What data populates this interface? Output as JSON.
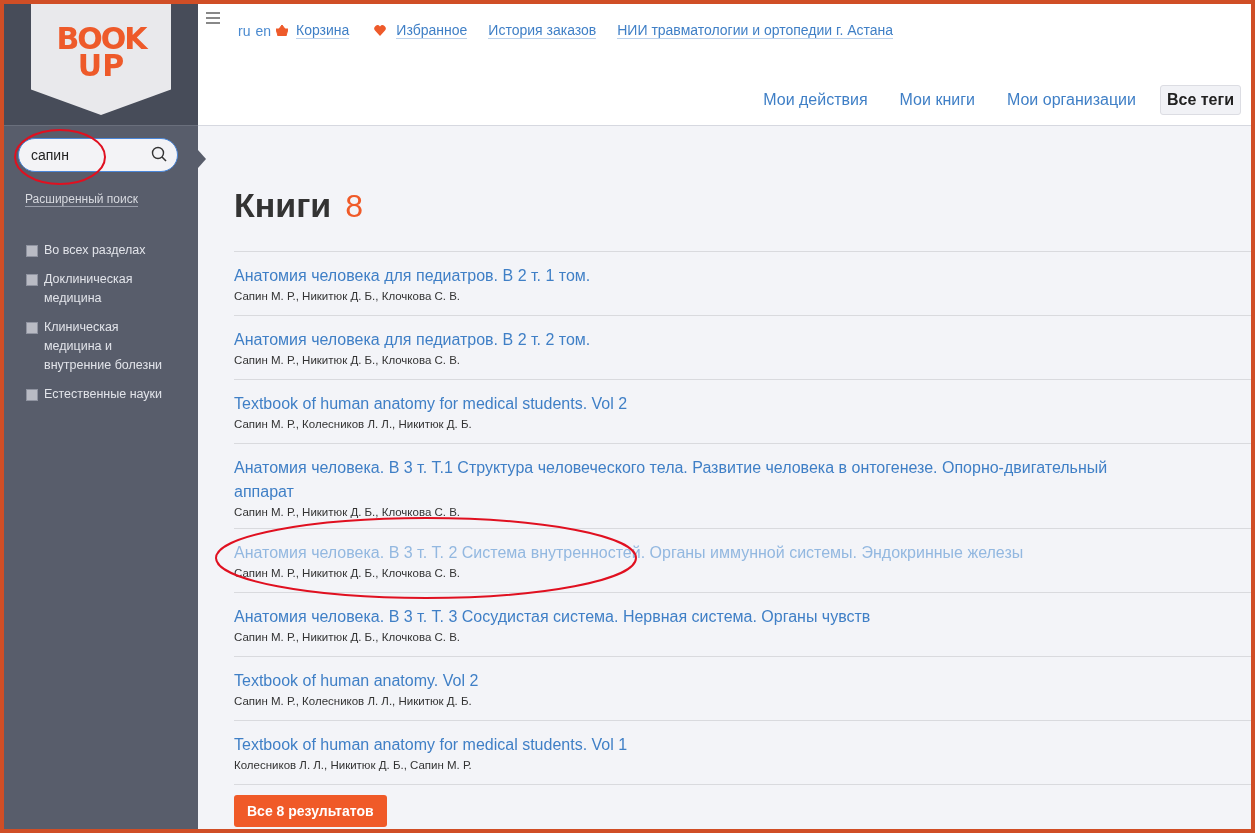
{
  "logo": {
    "top": "BOOK",
    "bottom": "UP"
  },
  "search": {
    "value": "сапин"
  },
  "advanced_search": "Расширенный поиск",
  "sections": [
    {
      "label": "Во всех разделах",
      "checked": false
    },
    {
      "label": "Доклиническая медицина",
      "checked": false
    },
    {
      "label": "Клиническая медицина и внутренние болезни",
      "checked": false
    },
    {
      "label": "Естественные науки",
      "checked": false
    }
  ],
  "top_links": {
    "languages": [
      "ru",
      "en"
    ],
    "items": [
      {
        "label": "Корзина",
        "kind": "cart"
      },
      {
        "label": "Избранное",
        "kind": "favorites"
      },
      {
        "label": "История заказов",
        "kind": "plain"
      },
      {
        "label": "НИИ травматологии и ортопедии г. Астана",
        "kind": "plain"
      }
    ]
  },
  "nav": [
    {
      "label": "Мои действия",
      "selected": false
    },
    {
      "label": "Мои книги",
      "selected": false
    },
    {
      "label": "Мои организации",
      "selected": false
    },
    {
      "label": "Все теги",
      "selected": true
    }
  ],
  "heading": {
    "title": "Книги",
    "count": "8"
  },
  "books": [
    {
      "title": "Анатомия человека для педиатров. В 2 т. 1 том.",
      "authors": "Сапин М. Р., Никитюк Д. Б., Клочкова С. В.",
      "hovered": false
    },
    {
      "title": "Анатомия человека для педиатров. В 2 т. 2 том.",
      "authors": "Сапин М. Р., Никитюк Д. Б., Клочкова С. В.",
      "hovered": false
    },
    {
      "title": "Textbook of human anatomy for medical students. Vol 2",
      "authors": "Сапин М. Р., Колесников Л. Л., Никитюк Д. Б.",
      "hovered": false
    },
    {
      "title": "Анатомия человека. В 3 т. Т.1 Структура человеческого тела. Развитие человека в онтогенезе. Опорно-двигательный аппарат",
      "authors": "Сапин М. Р., Никитюк Д. Б., Клочкова С. В.",
      "hovered": false
    },
    {
      "title": "Анатомия человека. В 3 т. Т. 2 Система внутренностей. Органы иммунной системы. Эндокринные железы",
      "authors": "Сапин М. Р., Никитюк Д. Б., Клочкова С. В.",
      "hovered": true
    },
    {
      "title": "Анатомия человека. В 3 т. Т. 3 Сосудистая система. Нервная система. Органы чувств",
      "authors": "Сапин М. Р., Никитюк Д. Б., Клочкова С. В.",
      "hovered": false
    },
    {
      "title": "Textbook of human anatomy. Vol 2",
      "authors": "Сапин М. Р., Колесников Л. Л., Никитюк Д. Б.",
      "hovered": false
    },
    {
      "title": "Textbook of human anatomy for medical students. Vol 1",
      "authors": "Колесников Л. Л., Никитюк Д. Б., Сапин М. Р.",
      "hovered": false
    }
  ],
  "all_results_button": "Все 8 результатов"
}
